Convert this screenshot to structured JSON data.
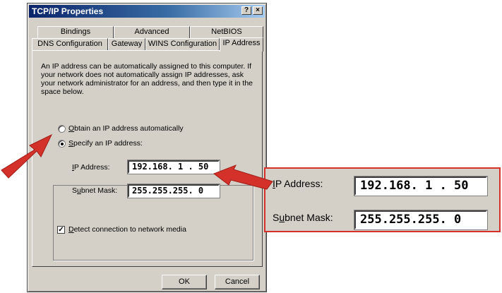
{
  "window": {
    "title": "TCP/IP Properties",
    "help_label": "?",
    "close_label": "×"
  },
  "tabs": {
    "row1": [
      "Bindings",
      "Advanced",
      "NetBIOS"
    ],
    "row2": [
      "DNS Configuration",
      "Gateway",
      "WINS Configuration",
      "IP Address"
    ],
    "active": "IP Address"
  },
  "description": "An IP address can be automatically assigned to this computer. If your network does not automatically assign IP addresses, ask your network administrator for an address, and then type it in the space below.",
  "options": {
    "auto": {
      "mnemonic": "O",
      "rest": "btain an IP address automatically",
      "selected": false
    },
    "specify": {
      "mnemonic": "S",
      "rest": "pecify an IP address:",
      "selected": true
    }
  },
  "fields": {
    "ip_label_mnemonic": "I",
    "ip_label_rest": "P Address:",
    "ip_value": "192.168. 1  . 50",
    "mask_label_pre": "S",
    "mask_label_mnemonic": "u",
    "mask_label_rest": "bnet Mask:",
    "mask_value": "255.255.255. 0"
  },
  "detect": {
    "mnemonic": "D",
    "rest": "etect connection to network media",
    "checked": true,
    "check_glyph": "✓"
  },
  "buttons": {
    "ok": "OK",
    "cancel": "Cancel"
  },
  "callout": {
    "ip_label_mnemonic": "I",
    "ip_label_rest": "P Address:",
    "ip_value": "192.168. 1  . 50",
    "mask_label_pre": "S",
    "mask_label_mnemonic": "u",
    "mask_label_rest": "bnet Mask:",
    "mask_value": "255.255.255. 0"
  },
  "colors": {
    "accent_red": "#d33129",
    "titlebar": "#0a246a",
    "face": "#d4d0c8"
  }
}
